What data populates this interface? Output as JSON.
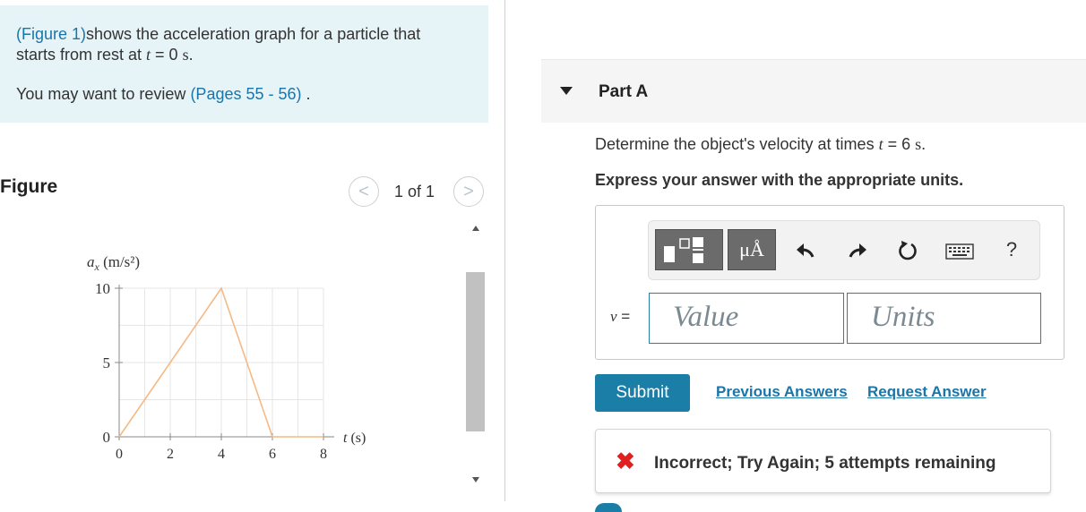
{
  "intro": {
    "figure_link": "(Figure 1)",
    "line1_rest": "shows the acceleration graph for a particle that",
    "line2_prefix": "starts from rest at ",
    "line2_var": "t",
    "line2_eq": " = 0 ",
    "line2_unit": "s",
    "line2_end": ".",
    "review_prefix": "You may want to review ",
    "review_link": "(Pages 55 - 56)",
    "review_suffix": " ."
  },
  "figure": {
    "heading": "Figure",
    "pager_text": "1 of 1",
    "prev_glyph": "<",
    "next_glyph": ">"
  },
  "chart_data": {
    "type": "line",
    "ylabel": "a",
    "ylabel_sub": "x",
    "ylabel_unit": " (m/s²)",
    "xlabel": "t (s)",
    "xlabel_var": "t",
    "xlabel_unit": " (s)",
    "x": [
      0,
      4,
      6,
      8
    ],
    "y": [
      0,
      10,
      0,
      0
    ],
    "xlim": [
      0,
      8
    ],
    "ylim": [
      0,
      10
    ],
    "xticks": [
      0,
      2,
      4,
      6,
      8
    ],
    "yticks": [
      0,
      5,
      10
    ],
    "grid": true,
    "line_color": "#f5b984"
  },
  "part": {
    "title": "Part A",
    "q_prefix": "Determine the object's velocity at times ",
    "q_var": "t",
    "q_eq": " = 6 ",
    "q_unit": "s",
    "q_end": ".",
    "instruction": "Express your answer with the appropriate units."
  },
  "toolbar": {
    "units_label": "μÅ",
    "help_label": "?"
  },
  "answer": {
    "var": "v",
    "eq": " =",
    "value_placeholder": "Value",
    "units_placeholder": "Units"
  },
  "actions": {
    "submit": "Submit",
    "previous": "Previous Answers",
    "request": "Request Answer"
  },
  "feedback": {
    "icon": "✖",
    "text": "Incorrect; Try Again; 5 attempts remaining"
  },
  "colors": {
    "accent": "#1b7ea6",
    "link": "#1a75a8",
    "intro_bg": "#e6f3f7",
    "error": "#e01f1f"
  }
}
